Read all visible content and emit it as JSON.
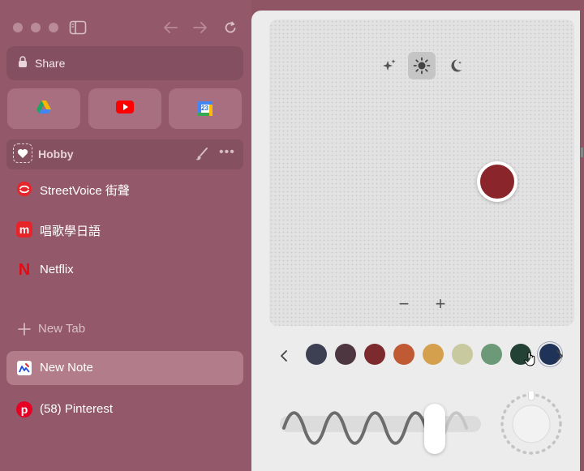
{
  "sidebar": {
    "share_label": "Share",
    "favorites": [
      {
        "name": "google-drive-icon"
      },
      {
        "name": "youtube-icon"
      },
      {
        "name": "google-calendar-icon",
        "text": "23"
      }
    ],
    "folder": {
      "label": "Hobby"
    },
    "tabs": [
      {
        "label": "StreetVoice 街聲",
        "icon": "streetvoice-icon"
      },
      {
        "label": "唱歌學日語",
        "icon": "m-app-icon",
        "icon_text": "m"
      },
      {
        "label": "Netflix",
        "icon": "netflix-icon",
        "icon_text": "N"
      }
    ],
    "new_tab_label": "New Tab",
    "pinned": [
      {
        "label": "New Note",
        "icon": "note-icon",
        "active": true
      },
      {
        "label": "(58) Pinterest",
        "icon": "pinterest-icon",
        "icon_text": "p",
        "active": false
      }
    ]
  },
  "panel": {
    "modes": [
      "sparkles-icon",
      "sun-icon",
      "moon-icon"
    ],
    "active_mode": "sun-icon",
    "zoom_out": "−",
    "zoom_in": "+",
    "selected_color": "#8a262b",
    "swatches": [
      "#3d3f52",
      "#4d3640",
      "#7c2a2e",
      "#c05a34",
      "#d5a04e",
      "#c9c9a0",
      "#6c9a78",
      "#234235",
      "#1f3257"
    ],
    "selected_swatch_index": 8
  },
  "colors": {
    "sidebar": "#93596a",
    "accent": "#8a262b"
  }
}
